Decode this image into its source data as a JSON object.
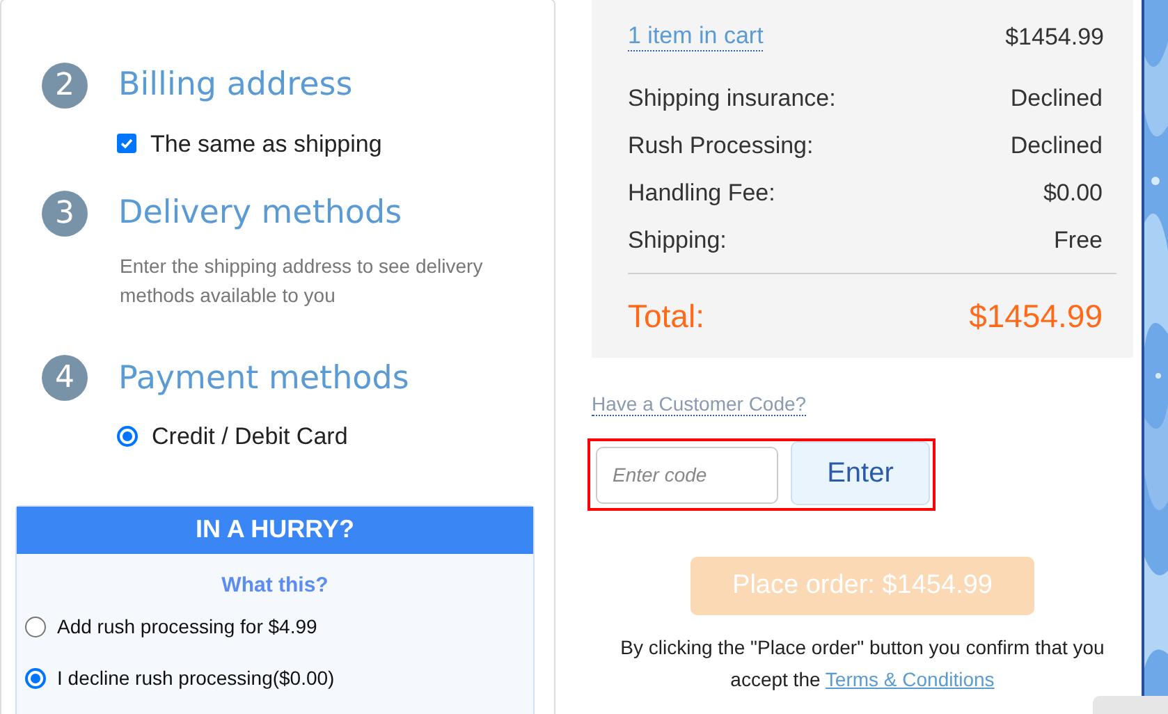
{
  "steps": [
    {
      "number": "2",
      "title": "Billing address",
      "kind": "checkbox",
      "label": "The same as shipping",
      "checked": true
    },
    {
      "number": "3",
      "title": "Delivery methods",
      "kind": "note",
      "text": "Enter the shipping address to see delivery methods available to you"
    },
    {
      "number": "4",
      "title": "Payment methods",
      "kind": "radio",
      "label": "Credit / Debit Card",
      "selected": true
    }
  ],
  "hurry": {
    "title": "IN A HURRY?",
    "link": "What this?",
    "options": [
      {
        "label": "Add rush processing for $4.99",
        "selected": false
      },
      {
        "label": "I decline rush processing($0.00)",
        "selected": true
      }
    ]
  },
  "summary": {
    "cart_link": "1 item in cart",
    "cart_total": "$1454.99",
    "rows": [
      {
        "label": "Shipping insurance:",
        "value": "Declined"
      },
      {
        "label": "Rush Processing:",
        "value": "Declined"
      },
      {
        "label": "Handling Fee:",
        "value": "$0.00"
      },
      {
        "label": "Shipping:",
        "value": "Free"
      }
    ],
    "total_label": "Total:",
    "total_value": "$1454.99"
  },
  "customer_code": {
    "link": "Have a Customer Code?",
    "placeholder": "Enter code",
    "button": "Enter",
    "highlighted": true
  },
  "place_order": {
    "button": "Place order: $1454.99",
    "disabled": true,
    "notice": "By clicking the \"Place order\" button you confirm that you accept the",
    "terms_link": "Terms & Conditions"
  }
}
